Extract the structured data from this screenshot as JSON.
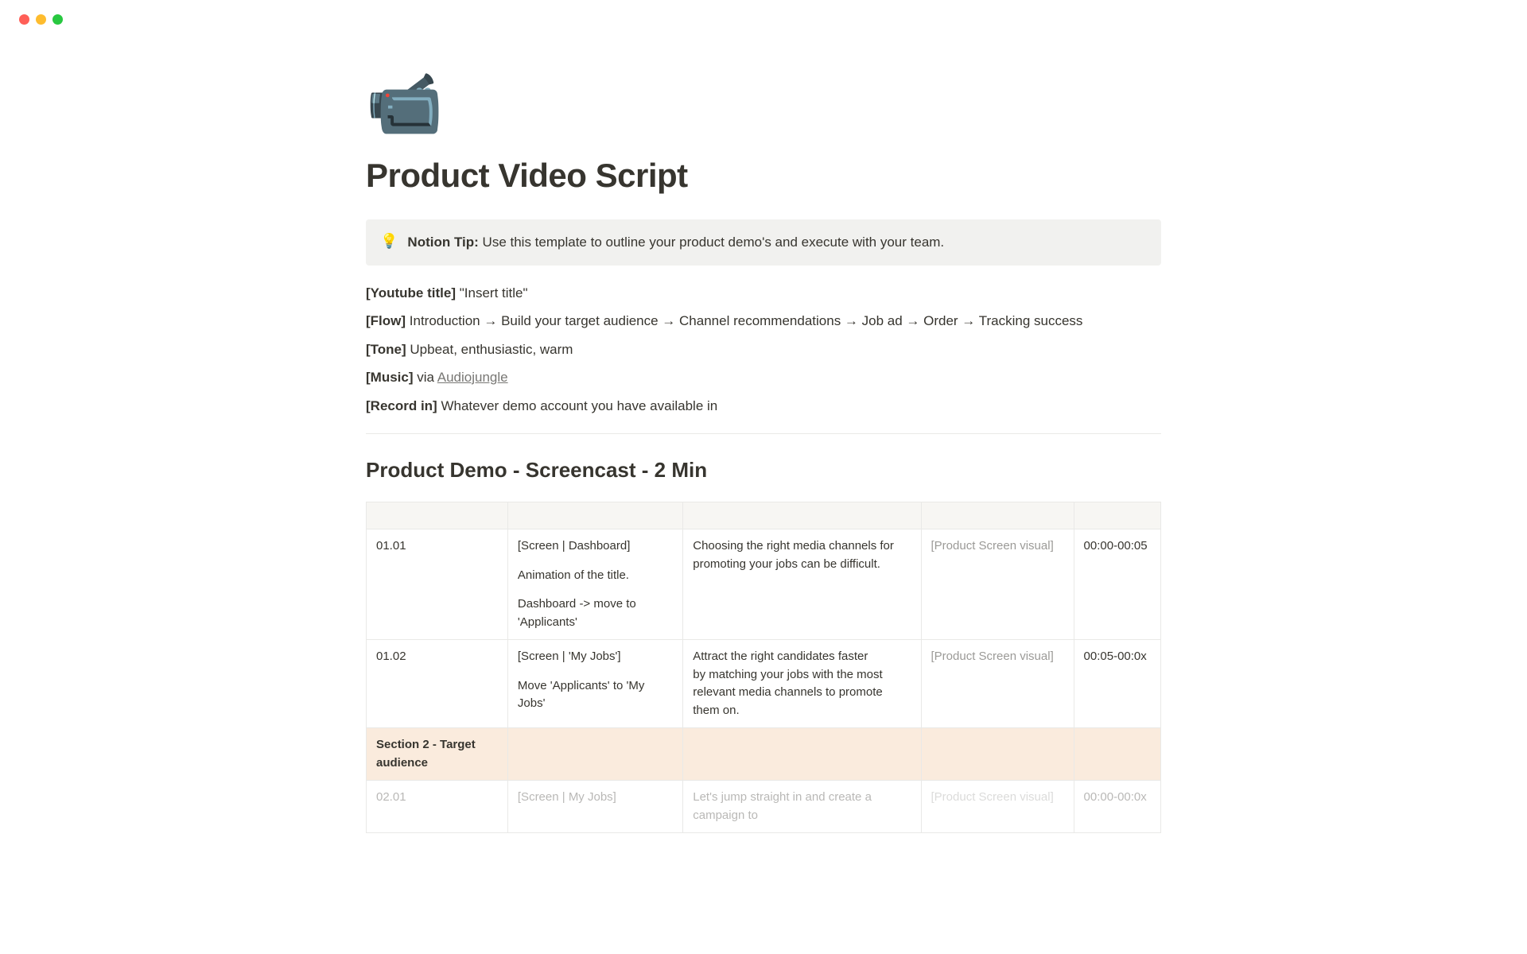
{
  "page": {
    "icon": "📹",
    "title": "Product Video Script"
  },
  "callout": {
    "icon": "💡",
    "label": "Notion Tip:",
    "text": "Use this template to outline your product demo's and execute with your team."
  },
  "meta": {
    "youtube_label": "[Youtube title]",
    "youtube_value": "\"Insert title\"",
    "flow_label": "[Flow]",
    "flow_value": "Introduction → Build your target audience → Channel recommendations → Job ad → Order → Tracking success",
    "tone_label": "[Tone]",
    "tone_value": "Upbeat, enthusiastic, warm",
    "music_label": "[Music]",
    "music_prefix": "via ",
    "music_link": "Audiojungle",
    "record_label": "[Record in]",
    "record_value": "Whatever demo account you have available in"
  },
  "section_heading": "Product Demo - Screencast - 2 Min",
  "table": {
    "rows": [
      {
        "id": "01.01",
        "screen_a": "[Screen | Dashboard]",
        "screen_b": "Animation of the title.",
        "screen_c": "Dashboard -> move to 'Applicants'",
        "narrative": "Choosing the right media channels for promoting your jobs can be difficult.",
        "visual": "[Product Screen visual]",
        "time": "00:00-00:05"
      },
      {
        "id": "01.02",
        "screen_a": "[Screen | 'My Jobs']",
        "screen_b": "Move 'Applicants' to 'My Jobs'",
        "narrative_a": "Attract the right candidates faster",
        "narrative_b": "by matching your jobs with the most relevant media channels to promote them on.",
        "visual": "[Product Screen visual]",
        "time": "00:05-00:0x"
      }
    ],
    "section_row": "Section 2 - Target audience",
    "partial": {
      "id": "02.01",
      "screen": "[Screen | My Jobs]",
      "narrative": "Let's jump straight in and create a campaign to",
      "visual": "[Product Screen visual]",
      "time": "00:00-00:0x"
    }
  }
}
